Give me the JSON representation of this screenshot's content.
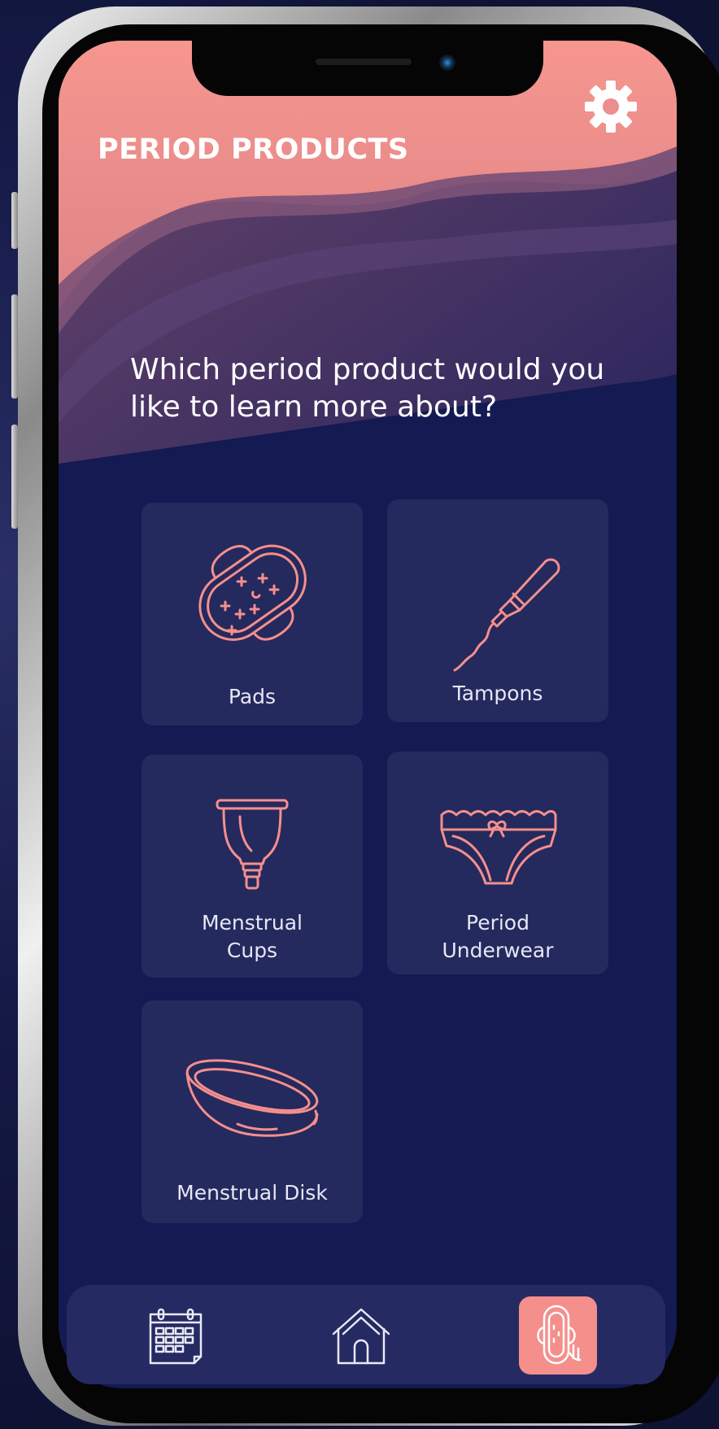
{
  "header": {
    "title": "PERIOD PRODUCTS",
    "settings_icon": "gear-icon"
  },
  "prompt": {
    "question": "Which period product would you like to learn more about?"
  },
  "products": [
    {
      "label": "Pads",
      "icon": "pad-icon"
    },
    {
      "label": "Tampons",
      "icon": "tampon-icon"
    },
    {
      "label": "Menstrual\nCups",
      "icon": "menstrual-cup-icon"
    },
    {
      "label": "Period\nUnderwear",
      "icon": "period-underwear-icon"
    },
    {
      "label": "Menstrual Disk",
      "icon": "menstrual-disk-icon"
    }
  ],
  "nav": {
    "items": [
      {
        "icon": "calendar-icon",
        "active": false
      },
      {
        "icon": "home-icon",
        "active": false
      },
      {
        "icon": "period-products-icon",
        "active": true
      }
    ]
  },
  "colors": {
    "background": "#141a52",
    "card": "#24295e",
    "accent": "#f48f8c",
    "header_pink": "#f3908e",
    "text": "#ffffff"
  }
}
